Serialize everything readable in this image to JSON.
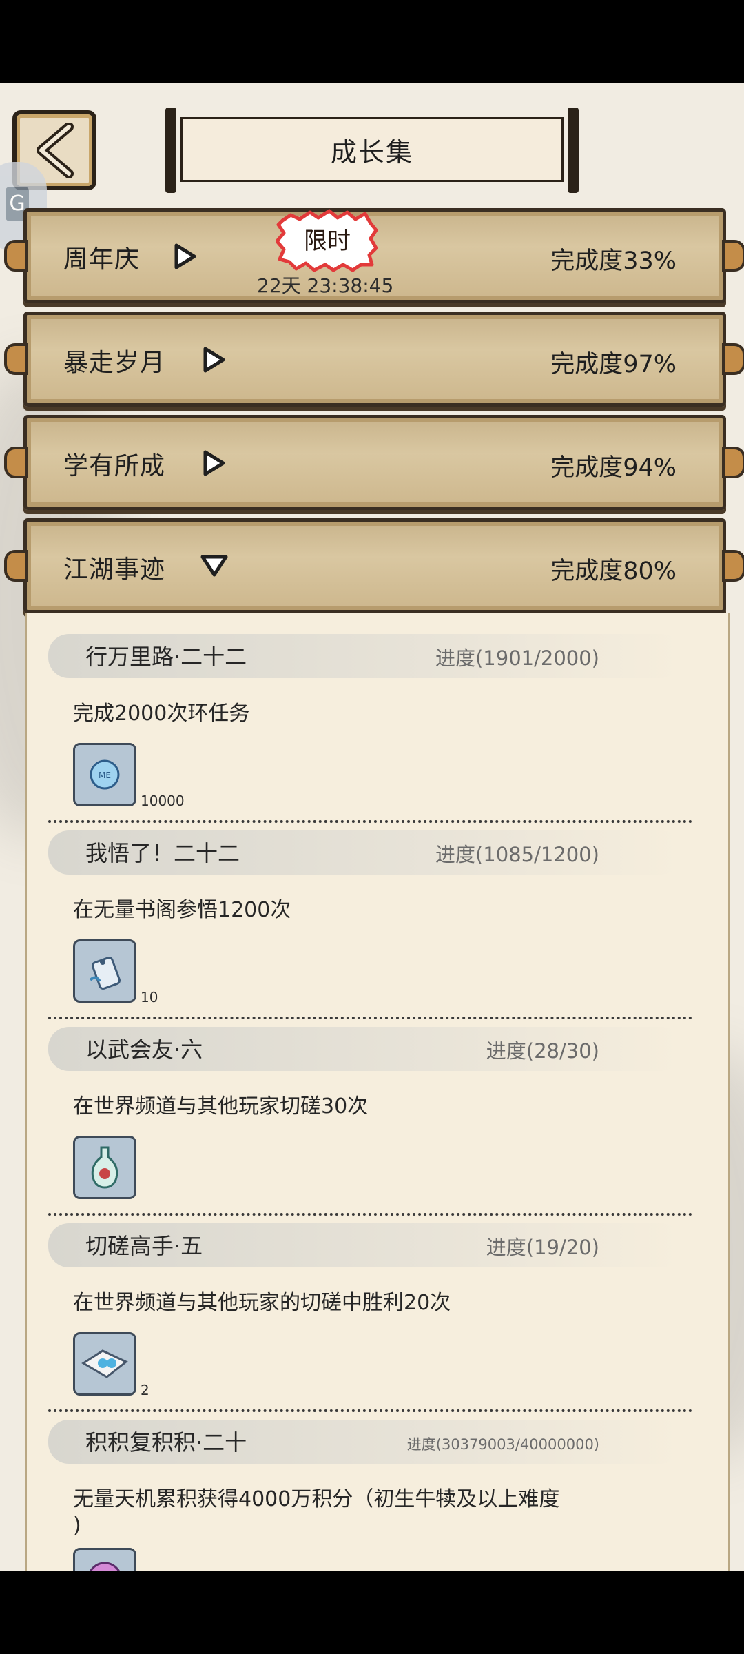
{
  "header": {
    "title": "成长集",
    "back_label": "back"
  },
  "categories": [
    {
      "name": "周年庆",
      "completion": "完成度33%",
      "expanded": false,
      "badge": "限时",
      "timer": "22天 23:38:45"
    },
    {
      "name": "暴走岁月",
      "completion": "完成度97%",
      "expanded": false
    },
    {
      "name": "学有所成",
      "completion": "完成度94%",
      "expanded": false
    },
    {
      "name": "江湖事迹",
      "completion": "完成度80%",
      "expanded": true
    }
  ],
  "tasks": [
    {
      "name": "行万里路·二十二",
      "progress": "进度(1901/2000)",
      "desc": "完成2000次环任务",
      "reward_icon": "coin-icon",
      "reward_count": "10000"
    },
    {
      "name": "我悟了！二十二",
      "progress": "进度(1085/1200)",
      "desc": "在无量书阁参悟1200次",
      "reward_icon": "tag-icon",
      "reward_count": "10"
    },
    {
      "name": "以武会友·六",
      "progress": "进度(28/30)",
      "desc": "在世界频道与其他玩家切磋30次",
      "reward_icon": "vase-icon",
      "reward_count": ""
    },
    {
      "name": "切磋高手·五",
      "progress": "进度(19/20)",
      "desc": "在世界频道与其他玩家的切磋中胜利20次",
      "reward_icon": "scroll-gem-icon",
      "reward_count": "2"
    },
    {
      "name": "积积复积积·二十",
      "progress": "进度(30379003/40000000)",
      "desc": "无量天机累积获得4000万积分（初生牛犊及以上难度",
      "desc2": ")",
      "reward_icon": "orb-icon",
      "reward_count": ""
    }
  ],
  "colors": {
    "bar": "#d9c7a1",
    "border": "#3a2e22",
    "paper": "#f6eedd",
    "badge": "#e23a3a"
  }
}
